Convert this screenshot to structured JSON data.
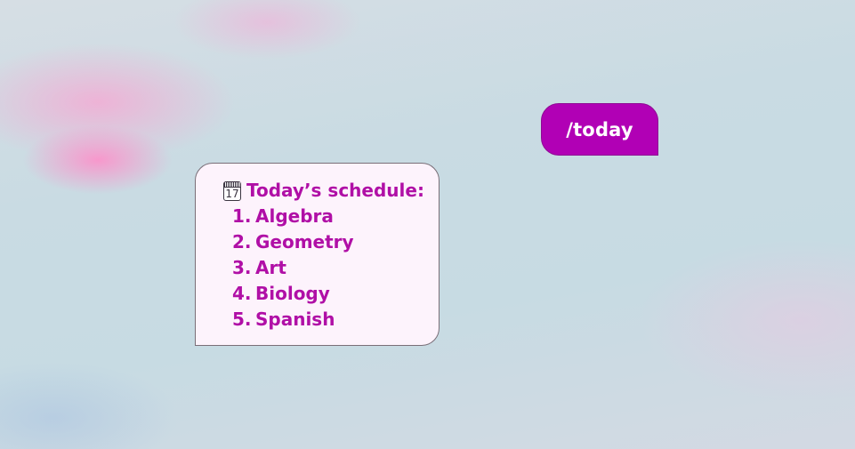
{
  "user_message": {
    "text": "/today"
  },
  "bot_message": {
    "icon": "calendar-icon",
    "icon_text": "17",
    "title": "Today’s schedule:",
    "items": [
      {
        "number": "1.",
        "label": "Algebra"
      },
      {
        "number": "2.",
        "label": "Geometry"
      },
      {
        "number": "3.",
        "label": "Art"
      },
      {
        "number": "4.",
        "label": "Biology"
      },
      {
        "number": "5.",
        "label": "Spanish"
      }
    ]
  },
  "colors": {
    "accent": "#b100b5",
    "bot_text": "#b00fa6",
    "bot_bubble_bg": "#fdf3fc"
  }
}
